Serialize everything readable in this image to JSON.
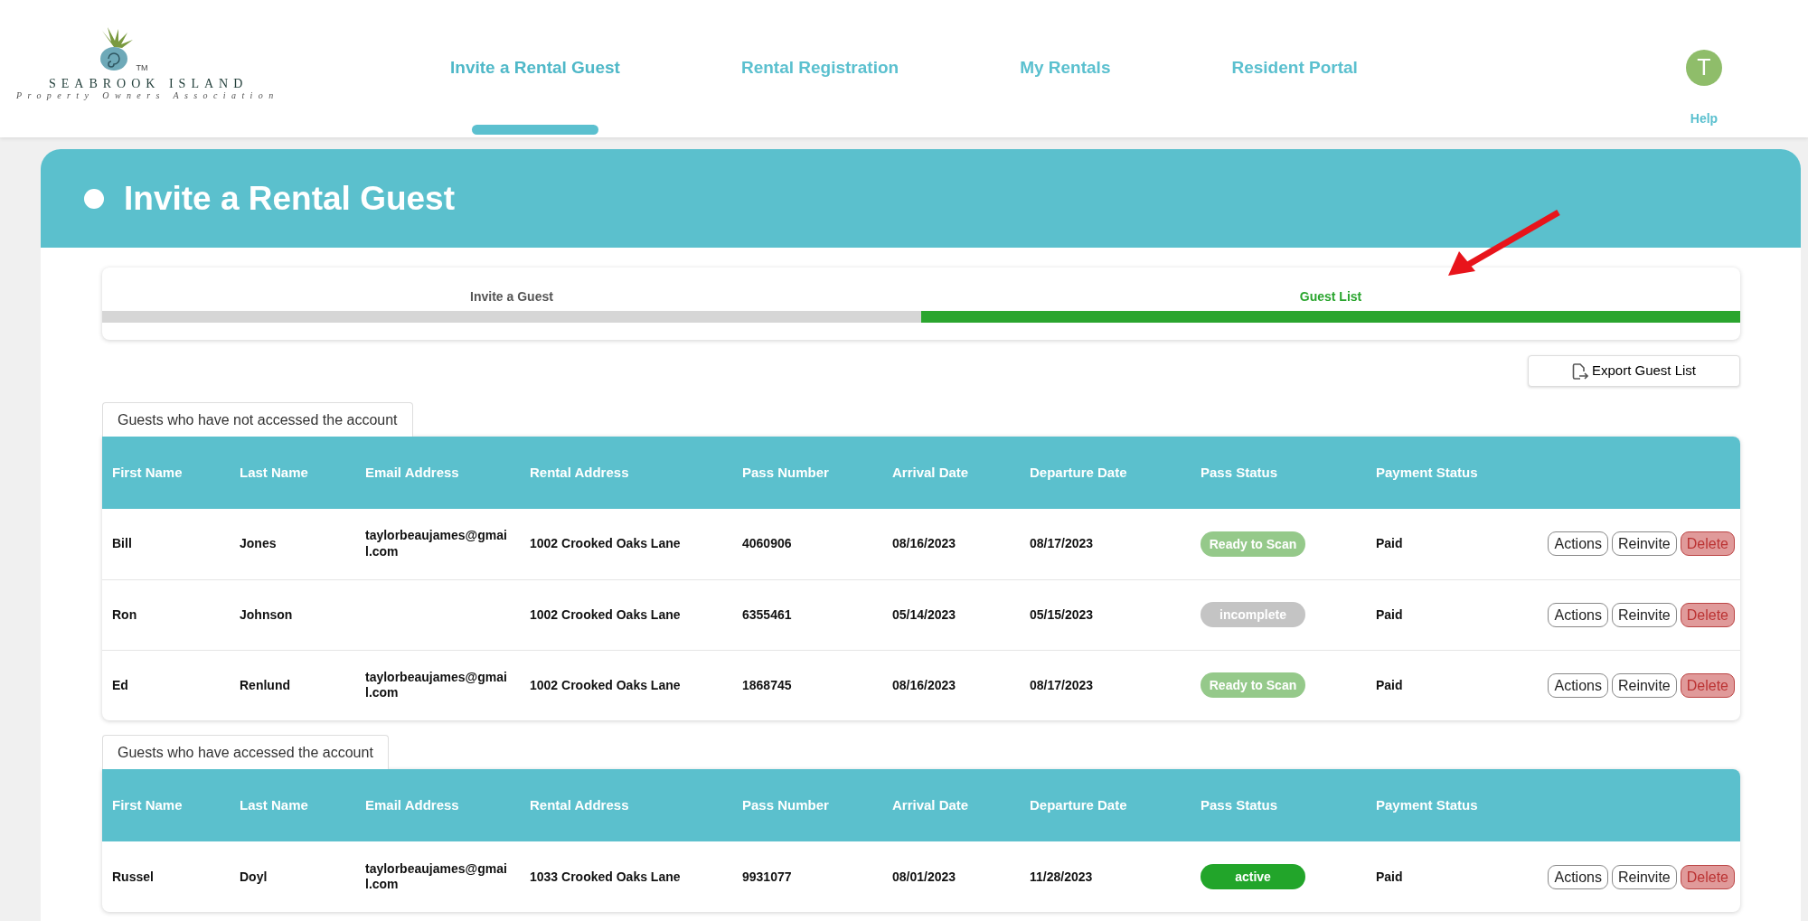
{
  "logo": {
    "name": "SEABROOK ISLAND",
    "tagline": "Property Owners Association",
    "trademark": "TM"
  },
  "nav": [
    {
      "label": "Invite a Rental Guest",
      "selected": true
    },
    {
      "label": "Rental Registration",
      "selected": false
    },
    {
      "label": "My Rentals",
      "selected": false
    },
    {
      "label": "Resident Portal",
      "selected": false
    }
  ],
  "user": {
    "initial": "T",
    "help": "Help"
  },
  "page_title": "Invite a Rental Guest",
  "steps": [
    {
      "label": "Invite a Guest",
      "selected": false
    },
    {
      "label": "Guest List",
      "selected": true
    }
  ],
  "export_button": "Export Guest List",
  "sections": [
    {
      "title": "Guests who have not accessed the account",
      "columns": [
        "First Name",
        "Last Name",
        "Email Address",
        "Rental Address",
        "Pass Number",
        "Arrival Date",
        "Departure Date",
        "Pass Status",
        "Payment Status"
      ],
      "rows": [
        {
          "first_name": "Bill",
          "last_name": "Jones",
          "email": "taylorbeaujames@gmail.com",
          "rental_address": "1002 Crooked Oaks Lane",
          "pass_number": "4060906",
          "arrival": "08/16/2023",
          "departure": "08/17/2023",
          "pass_status": {
            "text": "Ready to Scan",
            "color": "#95c98a"
          },
          "payment_status": "Paid",
          "actions": [
            {
              "label": "Actions",
              "kind": "outline"
            },
            {
              "label": "Reinvite",
              "kind": "outline"
            },
            {
              "label": "Delete",
              "kind": "danger"
            }
          ]
        },
        {
          "first_name": "Ron",
          "last_name": "Johnson",
          "rental_address": "1002 Crooked Oaks Lane",
          "pass_number": "6355461",
          "arrival": "05/14/2023",
          "departure": "05/15/2023",
          "pass_status": {
            "text": "incomplete",
            "color": "#c4c4c4"
          },
          "payment_status": "Paid",
          "actions": [
            {
              "label": "Actions",
              "kind": "outline"
            },
            {
              "label": "Reinvite",
              "kind": "outline"
            },
            {
              "label": "Delete",
              "kind": "danger"
            }
          ]
        },
        {
          "first_name": "Ed",
          "last_name": "Renlund",
          "email": "taylorbeaujames@gmail.com",
          "rental_address": "1002 Crooked Oaks Lane",
          "pass_number": "1868745",
          "arrival": "08/16/2023",
          "departure": "08/17/2023",
          "pass_status": {
            "text": "Ready to Scan",
            "color": "#95c98a"
          },
          "payment_status": "Paid",
          "actions": [
            {
              "label": "Actions",
              "kind": "outline"
            },
            {
              "label": "Reinvite",
              "kind": "outline"
            },
            {
              "label": "Delete",
              "kind": "danger"
            }
          ]
        }
      ]
    },
    {
      "title": "Guests who have accessed the account",
      "columns": [
        "First Name",
        "Last Name",
        "Email Address",
        "Rental Address",
        "Pass Number",
        "Arrival Date",
        "Departure Date",
        "Pass Status",
        "Payment Status"
      ],
      "rows": [
        {
          "first_name": "Russel",
          "last_name": "Doyl",
          "email": "taylorbeaujames@gmail.com",
          "rental_address": "1033 Crooked Oaks Lane",
          "pass_number": "9931077",
          "arrival": "08/01/2023",
          "departure": "11/28/2023",
          "pass_status": {
            "text": "active",
            "color": "#22a52a"
          },
          "payment_status": "Paid",
          "actions": [
            {
              "label": "Actions",
              "kind": "outline"
            },
            {
              "label": "Reinvite",
              "kind": "outline"
            },
            {
              "label": "Delete",
              "kind": "danger"
            }
          ]
        }
      ]
    }
  ]
}
